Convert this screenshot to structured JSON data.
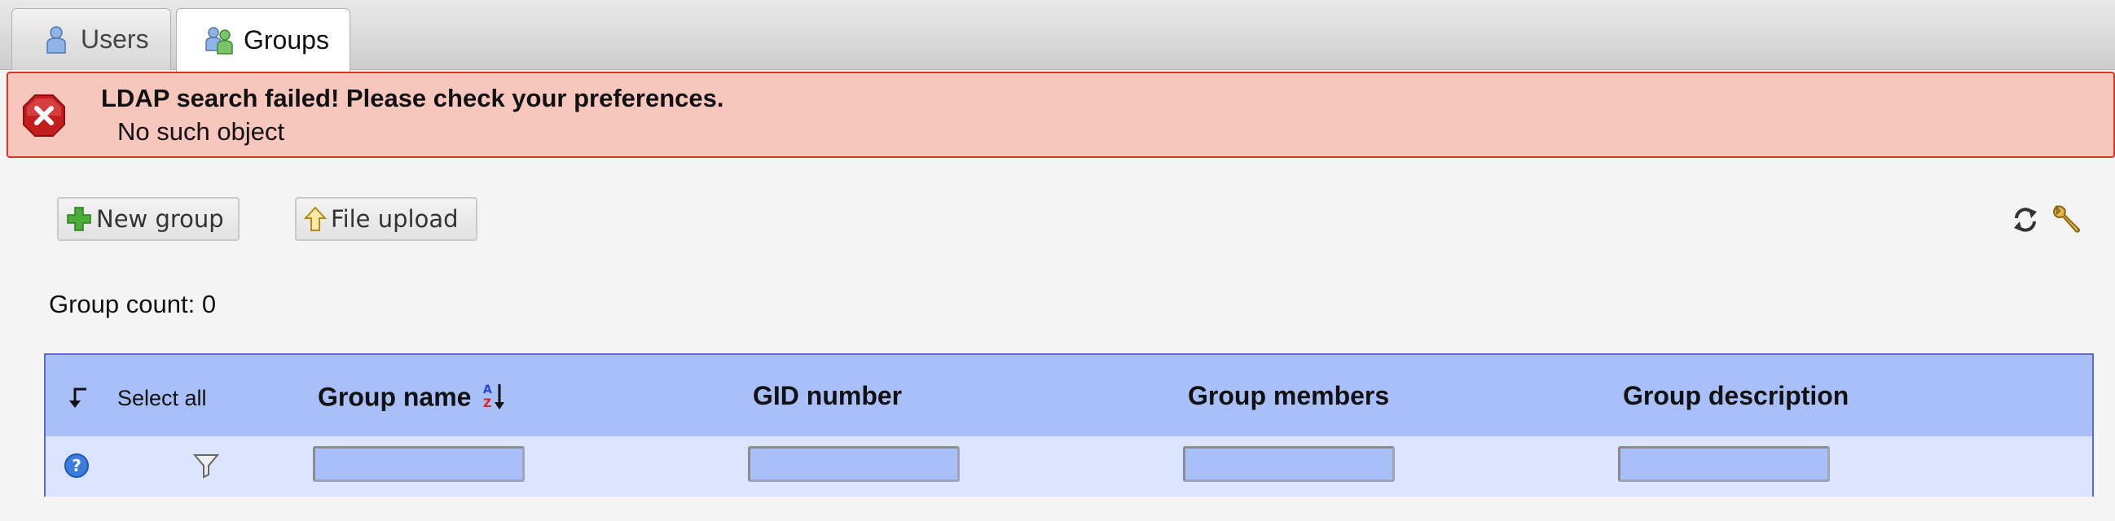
{
  "tabs": [
    {
      "label": "Users",
      "icon": "user-icon",
      "active": false
    },
    {
      "label": "Groups",
      "icon": "group-icon",
      "active": true
    }
  ],
  "error": {
    "title": "LDAP search failed! Please check your preferences.",
    "detail": "No such object",
    "icon": "error-icon"
  },
  "toolbar": {
    "new_group_label": "New group",
    "file_upload_label": "File upload",
    "refresh_icon": "refresh-icon",
    "settings_icon": "wrench-icon"
  },
  "group_count": "Group count: 0",
  "table": {
    "select_all_label": "Select all",
    "columns": [
      {
        "label": "Group name",
        "sortable": true
      },
      {
        "label": "GID number"
      },
      {
        "label": "Group members"
      },
      {
        "label": "Group description"
      }
    ],
    "filters": [
      "",
      "",
      "",
      ""
    ],
    "help_icon": "help-icon",
    "filter_icon": "filter-icon"
  },
  "colors": {
    "error_bg": "#f7c6bd",
    "error_border": "#d6372b",
    "header_bg": "#a9bff9",
    "filter_row_bg": "#dae4fc",
    "table_border": "#5d6bc9"
  }
}
